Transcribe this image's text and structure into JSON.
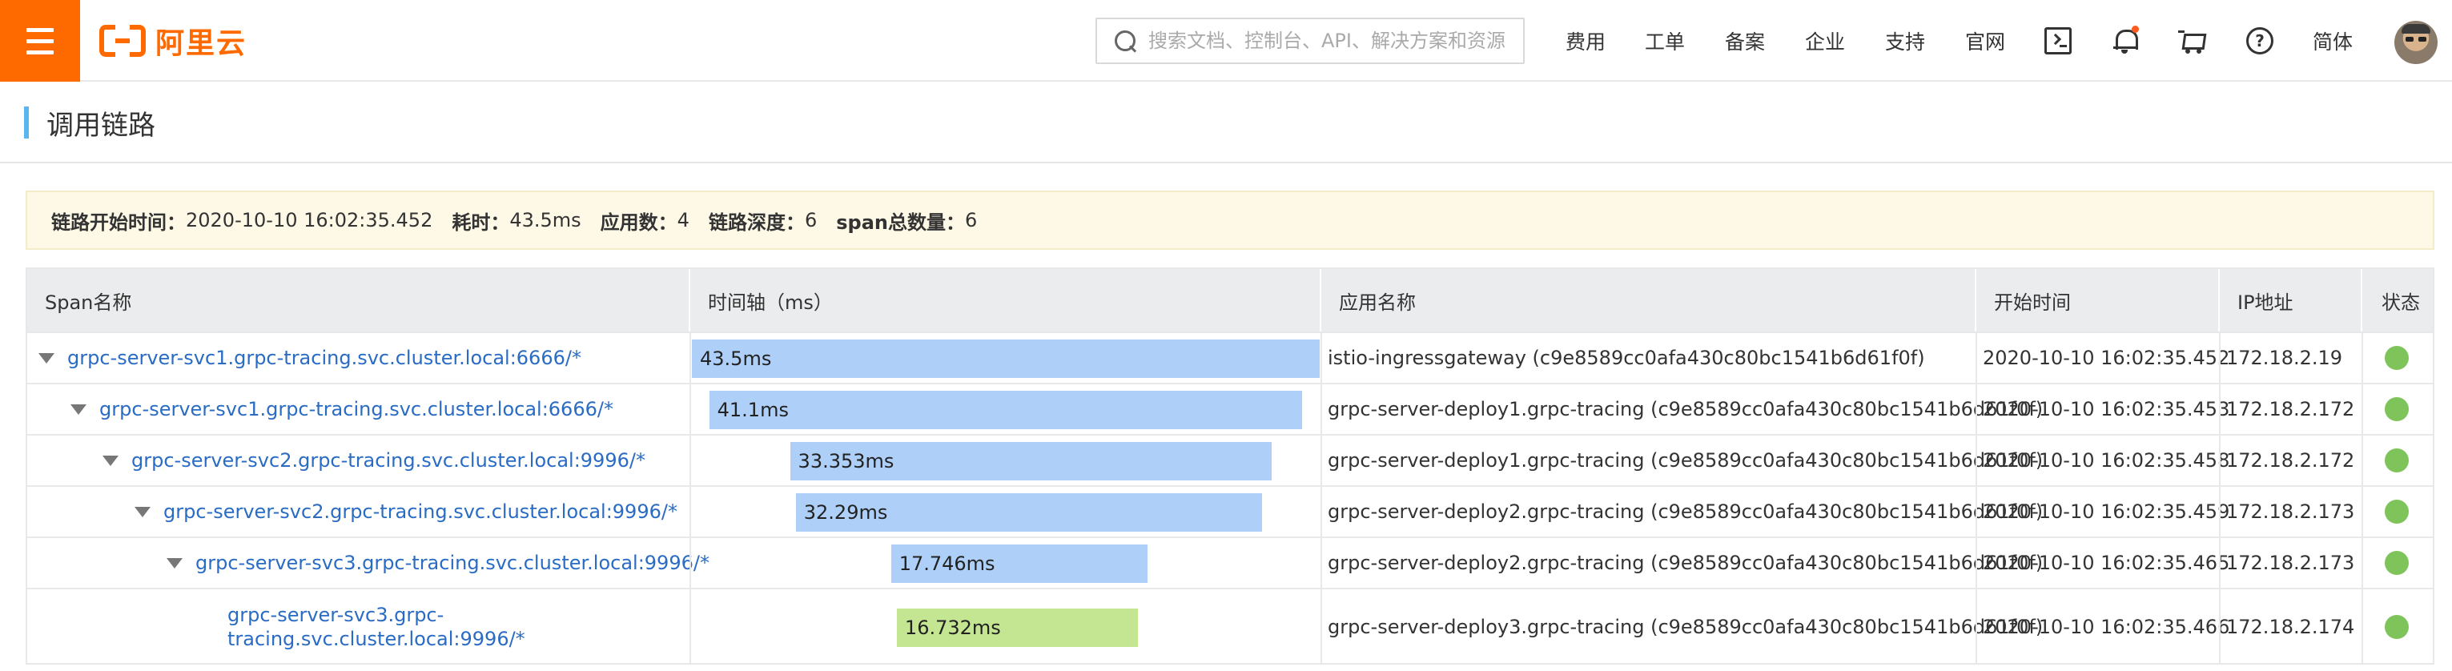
{
  "header": {
    "logo_text": "阿里云",
    "search_placeholder": "搜索文档、控制台、API、解决方案和资源",
    "nav": [
      "费用",
      "工单",
      "备案",
      "企业",
      "支持",
      "官网"
    ],
    "lang": "简体",
    "icons": [
      "menu-icon",
      "terminal-icon",
      "bell-icon",
      "cart-icon",
      "help-icon"
    ],
    "accent_color": "#ff6a00"
  },
  "page": {
    "title": "调用链路"
  },
  "summary": {
    "start_label": "链路开始时间：",
    "start_value": "2020-10-10 16:02:35.452",
    "duration_label": "耗时：",
    "duration_value": "43.5ms",
    "apps_label": "应用数：",
    "apps_value": "4",
    "depth_label": "链路深度：",
    "depth_value": "6",
    "spans_label": "span总数量：",
    "spans_value": "6"
  },
  "table": {
    "columns": [
      "Span名称",
      "时间轴（ms）",
      "应用名称",
      "开始时间",
      "IP地址",
      "状态"
    ],
    "total_ms": 43.5,
    "rows": [
      {
        "name": "grpc-server-svc1.grpc-tracing.svc.cluster.local:6666/*",
        "depth": 0,
        "expandable": true,
        "duration": "43.5ms",
        "duration_ms": 43.5,
        "offset_ms": 0,
        "bar_color": "#aed0f8",
        "app": "istio-ingressgateway (c9e8589cc0afa430c80bc1541b6d61f0f)",
        "start": "2020-10-10 16:02:35.452",
        "ip": "172.18.2.19",
        "status_color": "#7ec45a"
      },
      {
        "name": "grpc-server-svc1.grpc-tracing.svc.cluster.local:6666/*",
        "depth": 1,
        "expandable": true,
        "duration": "41.1ms",
        "duration_ms": 41.1,
        "offset_ms": 1.2,
        "bar_color": "#aed0f8",
        "app": "grpc-server-deploy1.grpc-tracing (c9e8589cc0afa430c80bc1541b6d61f0f)",
        "start": "2020-10-10 16:02:35.453",
        "ip": "172.18.2.172",
        "status_color": "#7ec45a"
      },
      {
        "name": "grpc-server-svc2.grpc-tracing.svc.cluster.local:9996/*",
        "depth": 2,
        "expandable": true,
        "duration": "33.353ms",
        "duration_ms": 33.353,
        "offset_ms": 6.8,
        "bar_color": "#aed0f8",
        "app": "grpc-server-deploy1.grpc-tracing (c9e8589cc0afa430c80bc1541b6d61f0f)",
        "start": "2020-10-10 16:02:35.458",
        "ip": "172.18.2.172",
        "status_color": "#7ec45a"
      },
      {
        "name": "grpc-server-svc2.grpc-tracing.svc.cluster.local:9996/*",
        "depth": 3,
        "expandable": true,
        "duration": "32.29ms",
        "duration_ms": 32.29,
        "offset_ms": 7.2,
        "bar_color": "#aed0f8",
        "app": "grpc-server-deploy2.grpc-tracing (c9e8589cc0afa430c80bc1541b6d61f0f)",
        "start": "2020-10-10 16:02:35.459",
        "ip": "172.18.2.173",
        "status_color": "#7ec45a"
      },
      {
        "name": "grpc-server-svc3.grpc-tracing.svc.cluster.local:9996/*",
        "depth": 4,
        "expandable": true,
        "duration": "17.746ms",
        "duration_ms": 17.746,
        "offset_ms": 13.8,
        "bar_color": "#aed0f8",
        "app": "grpc-server-deploy2.grpc-tracing (c9e8589cc0afa430c80bc1541b6d61f0f)",
        "start": "2020-10-10 16:02:35.465",
        "ip": "172.18.2.173",
        "status_color": "#7ec45a"
      },
      {
        "name": "grpc-server-svc3.grpc-tracing.svc.cluster.local:9996/*",
        "depth": 5,
        "expandable": false,
        "duration": "16.732ms",
        "duration_ms": 16.732,
        "offset_ms": 14.2,
        "bar_color": "#c4e592",
        "app": "grpc-server-deploy3.grpc-tracing (c9e8589cc0afa430c80bc1541b6d61f0f)",
        "start": "2020-10-10 16:02:35.466",
        "ip": "172.18.2.174",
        "status_color": "#7ec45a"
      }
    ]
  }
}
